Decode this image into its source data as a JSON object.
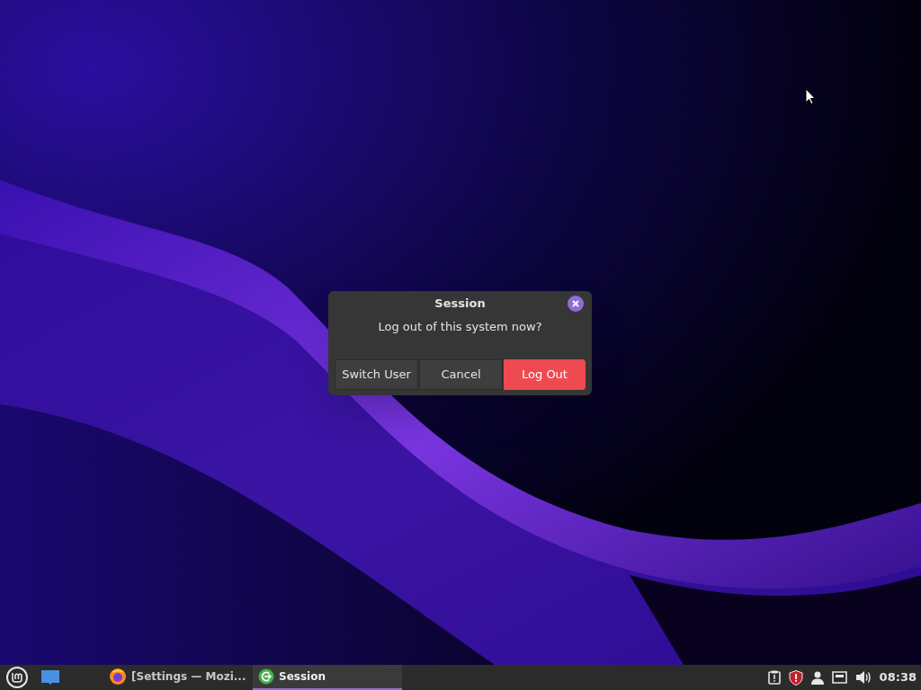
{
  "dialog": {
    "title": "Session",
    "message": "Log out of this system now?",
    "buttons": [
      {
        "label": "Switch User",
        "kind": "normal"
      },
      {
        "label": "Cancel",
        "kind": "normal"
      },
      {
        "label": "Log Out",
        "kind": "destructive"
      }
    ]
  },
  "taskbar": {
    "windows": [
      {
        "label": "[Settings — Mozi...",
        "kind": "browser",
        "selected": false
      },
      {
        "label": "Session",
        "kind": "session",
        "selected": true
      }
    ],
    "clock": "08:38"
  }
}
